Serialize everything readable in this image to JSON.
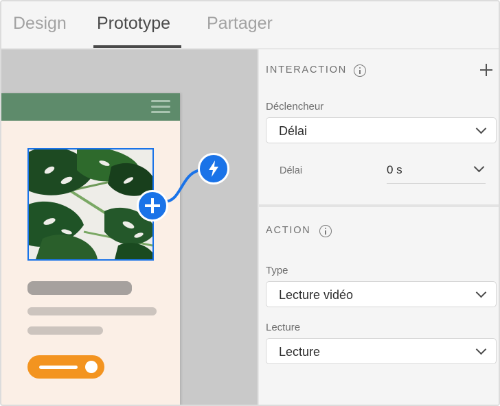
{
  "tabs": [
    {
      "label": "Design",
      "active": false
    },
    {
      "label": "Prototype",
      "active": true
    },
    {
      "label": "Partager",
      "active": false
    }
  ],
  "colors": {
    "accent": "#1a73e8",
    "artboard_header": "#5e8b6b",
    "artboard_bg": "#fbefe6",
    "toggle": "#f39420",
    "canvas": "#c9c9c9"
  },
  "canvas": {
    "icons": [
      "hamburger-menu-icon",
      "plus-icon",
      "lightning-bolt-icon"
    ],
    "image_subject": "monstera leaves photo"
  },
  "interaction": {
    "title": "INTERACTION",
    "trigger_label": "Déclencheur",
    "trigger_value": "Délai",
    "delay_label": "Délai",
    "delay_value": "0 s"
  },
  "action": {
    "title": "ACTION",
    "type_label": "Type",
    "type_value": "Lecture vidéo",
    "playback_label": "Lecture",
    "playback_value": "Lecture"
  }
}
